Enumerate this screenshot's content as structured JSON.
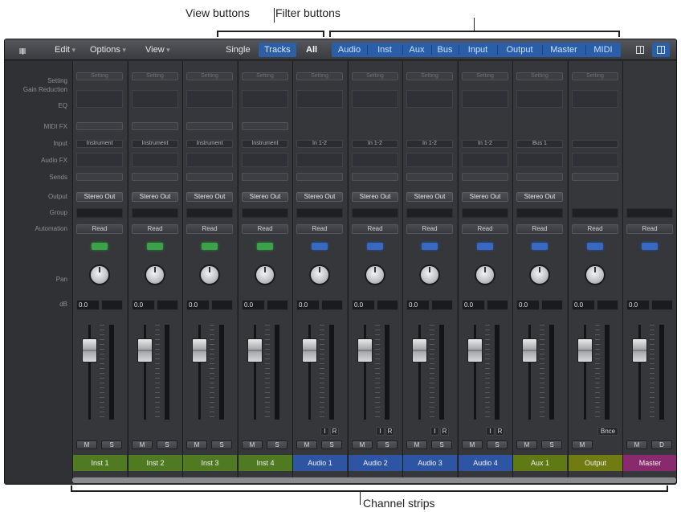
{
  "callouts": {
    "view_buttons": "View buttons",
    "filter_buttons": "Filter buttons",
    "channel_strips": "Channel strips"
  },
  "toolbar": {
    "menus": [
      "Edit",
      "Options",
      "View"
    ],
    "view_buttons": [
      {
        "label": "Single",
        "selected": false
      },
      {
        "label": "Tracks",
        "selected": true
      },
      {
        "label": "All",
        "selected": false
      }
    ],
    "filter_buttons": [
      "Audio",
      "Inst",
      "Aux",
      "Bus",
      "Input",
      "Output",
      "Master",
      "MIDI"
    ],
    "icons": [
      "lock-icon",
      "single-pane-icon",
      "double-pane-icon"
    ]
  },
  "row_labels": [
    "Setting",
    "Gain Reduction",
    "EQ",
    "MIDI FX",
    "Input",
    "Audio FX",
    "Sends",
    "Output",
    "Group",
    "Automation",
    "Pan",
    "dB"
  ],
  "strips": [
    {
      "name": "Inst 1",
      "setting": "Setting",
      "input": "Instrument",
      "output": "Stereo Out",
      "automation": "Read",
      "icon": "green",
      "db": "0.0",
      "mute": "M",
      "solo": "S",
      "color": "#4f7a22",
      "midi_fx": true,
      "ir": false,
      "bnce": false
    },
    {
      "name": "Inst 2",
      "setting": "Setting",
      "input": "Instrument",
      "output": "Stereo Out",
      "automation": "Read",
      "icon": "green",
      "db": "0.0",
      "mute": "M",
      "solo": "S",
      "color": "#4f7a22",
      "midi_fx": true,
      "ir": false,
      "bnce": false
    },
    {
      "name": "Inst 3",
      "setting": "Setting",
      "input": "Instrument",
      "output": "Stereo Out",
      "automation": "Read",
      "icon": "green",
      "db": "0.0",
      "mute": "M",
      "solo": "S",
      "color": "#4f7a22",
      "midi_fx": true,
      "ir": false,
      "bnce": false
    },
    {
      "name": "Inst 4",
      "setting": "Setting",
      "input": "Instrument",
      "output": "Stereo Out",
      "automation": "Read",
      "icon": "green",
      "db": "0.0",
      "mute": "M",
      "solo": "S",
      "color": "#4f7a22",
      "midi_fx": true,
      "ir": false,
      "bnce": false
    },
    {
      "name": "Audio 1",
      "setting": "Setting",
      "input": "In 1-2",
      "output": "Stereo Out",
      "automation": "Read",
      "icon": "blue",
      "db": "0.0",
      "mute": "M",
      "solo": "S",
      "color": "#2d55a3",
      "midi_fx": false,
      "ir": true,
      "bnce": false
    },
    {
      "name": "Audio 2",
      "setting": "Setting",
      "input": "In 1-2",
      "output": "Stereo Out",
      "automation": "Read",
      "icon": "blue",
      "db": "0.0",
      "mute": "M",
      "solo": "S",
      "color": "#2d55a3",
      "midi_fx": false,
      "ir": true,
      "bnce": false
    },
    {
      "name": "Audio 3",
      "setting": "Setting",
      "input": "In 1-2",
      "output": "Stereo Out",
      "automation": "Read",
      "icon": "blue",
      "db": "0.0",
      "mute": "M",
      "solo": "S",
      "color": "#2d55a3",
      "midi_fx": false,
      "ir": true,
      "bnce": false
    },
    {
      "name": "Audio 4",
      "setting": "Setting",
      "input": "In 1-2",
      "output": "Stereo Out",
      "automation": "Read",
      "icon": "blue",
      "db": "0.0",
      "mute": "M",
      "solo": "S",
      "color": "#2d55a3",
      "midi_fx": false,
      "ir": true,
      "bnce": false
    },
    {
      "name": "Aux 1",
      "setting": "Setting",
      "input": "Bus 1",
      "output": "Stereo Out",
      "automation": "Read",
      "icon": "blue",
      "db": "0.0",
      "mute": "M",
      "solo": "S",
      "color": "#5f7a14",
      "midi_fx": false,
      "ir": false,
      "bnce": false
    },
    {
      "name": "Output",
      "setting": "Setting",
      "input": "",
      "output": "",
      "automation": "Read",
      "icon": "blue",
      "db": "0.0",
      "mute": "M",
      "solo": "",
      "color": "#707b12",
      "midi_fx": false,
      "ir": false,
      "bnce": true
    },
    {
      "name": "Master",
      "setting": "",
      "input": "",
      "output": "",
      "automation": "Read",
      "icon": "blue",
      "db": "0.0",
      "mute": "M",
      "solo": "D",
      "color": "#8a2a6e",
      "midi_fx": false,
      "ir": false,
      "bnce": false
    }
  ],
  "ir_labels": {
    "i": "I",
    "r": "R"
  },
  "bnce_label": "Bnce"
}
